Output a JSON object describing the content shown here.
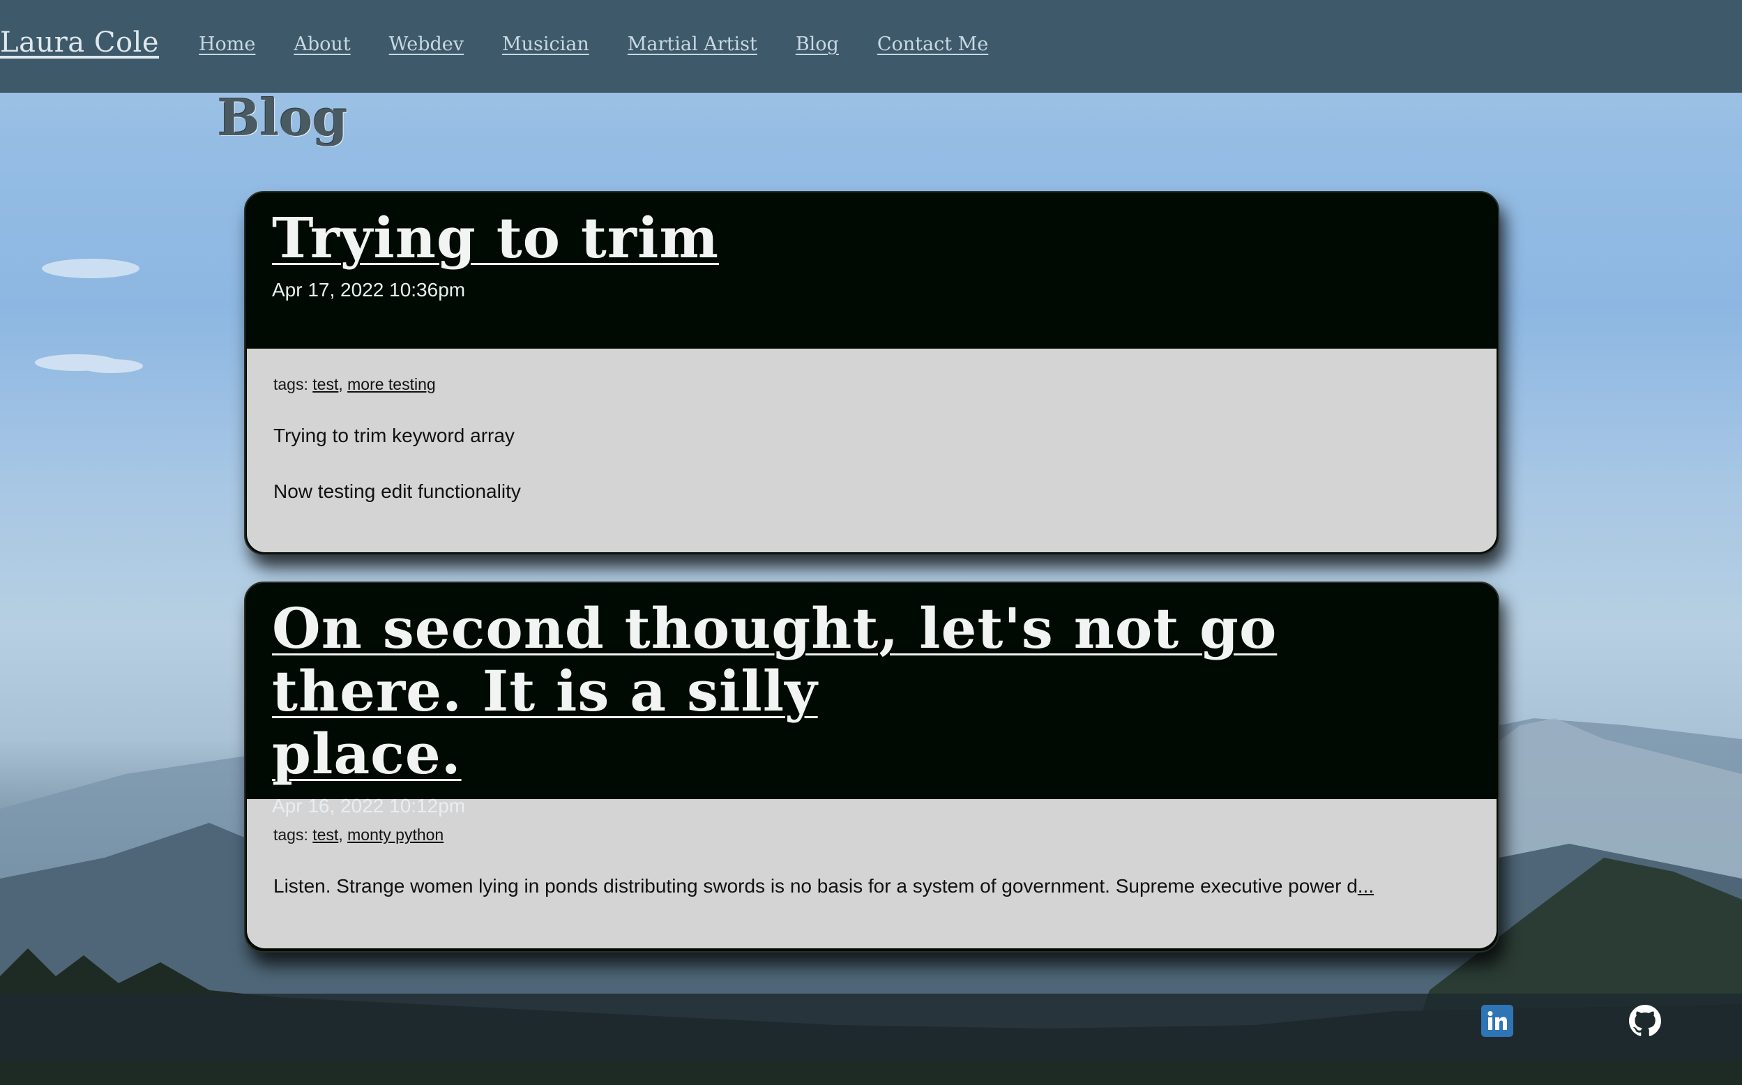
{
  "header": {
    "brand": "Laura Cole",
    "nav": [
      {
        "label": "Home"
      },
      {
        "label": "About"
      },
      {
        "label": "Webdev"
      },
      {
        "label": "Musician"
      },
      {
        "label": "Martial Artist"
      },
      {
        "label": "Blog"
      },
      {
        "label": "Contact Me"
      }
    ]
  },
  "page": {
    "title": "Blog"
  },
  "posts": [
    {
      "title": "Trying to trim",
      "date": "Apr 17, 2022 10:36pm",
      "tags_label": "tags:",
      "tags": [
        "test",
        "more testing"
      ],
      "paragraphs": [
        "Trying to trim keyword array",
        "Now testing edit functionality"
      ]
    },
    {
      "title_line1": "On second thought, let's not go there. It is a silly",
      "title_line2": "place.",
      "date": "Apr 16, 2022 10:12pm",
      "tags_label": "tags:",
      "tags": [
        "test",
        "monty python"
      ],
      "excerpt": "Listen. Strange women lying in ponds distributing swords is no basis for a system of government. Supreme executive power d",
      "more": "..."
    }
  ],
  "footer": {
    "icons": [
      "linkedin-icon",
      "github-icon"
    ],
    "linkedin_text": "in"
  },
  "colors": {
    "navbar": "#3e5a6a",
    "card_header": "#000a03",
    "card_body": "#d4d4d4",
    "linkedin": "#2f74b4"
  }
}
